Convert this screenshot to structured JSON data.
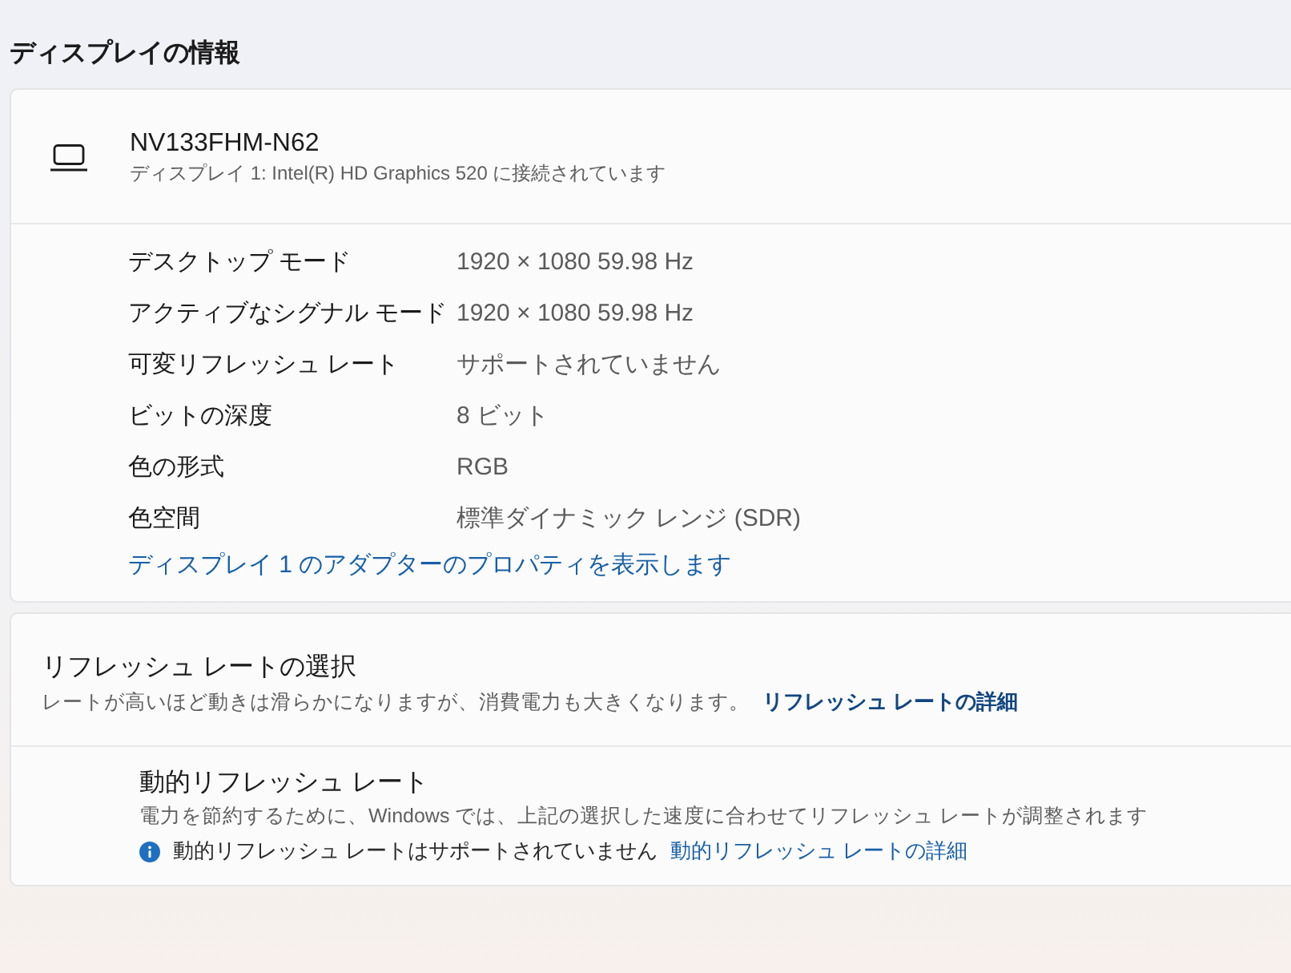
{
  "section_title": "ディスプレイの情報",
  "display_card": {
    "name": "NV133FHM-N62",
    "subtitle": "ディスプレイ 1: Intel(R) HD Graphics 520 に接続されています",
    "properties": [
      {
        "label": "デスクトップ モード",
        "value": "1920 × 1080 59.98 Hz"
      },
      {
        "label": "アクティブなシグナル モード",
        "value": "1920 × 1080 59.98 Hz"
      },
      {
        "label": "可変リフレッシュ レート",
        "value": "サポートされていません"
      },
      {
        "label": "ビットの深度",
        "value": "8 ビット"
      },
      {
        "label": "色の形式",
        "value": "RGB"
      },
      {
        "label": "色空間",
        "value": "標準ダイナミック レンジ (SDR)"
      }
    ],
    "link": "ディスプレイ 1 のアダプターのプロパティを表示します"
  },
  "refresh_card": {
    "title": "リフレッシュ レートの選択",
    "description": "レートが高いほど動きは滑らかになりますが、消費電力も大きくなります。",
    "link": "リフレッシュ レートの詳細",
    "dynamic": {
      "title": "動的リフレッシュ レート",
      "description": "電力を節約するために、Windows では、上記の選択した速度に合わせてリフレッシュ レートが調整されます",
      "notice": "動的リフレッシュ レートはサポートされていません",
      "link": "動的リフレッシュ レートの詳細"
    }
  }
}
